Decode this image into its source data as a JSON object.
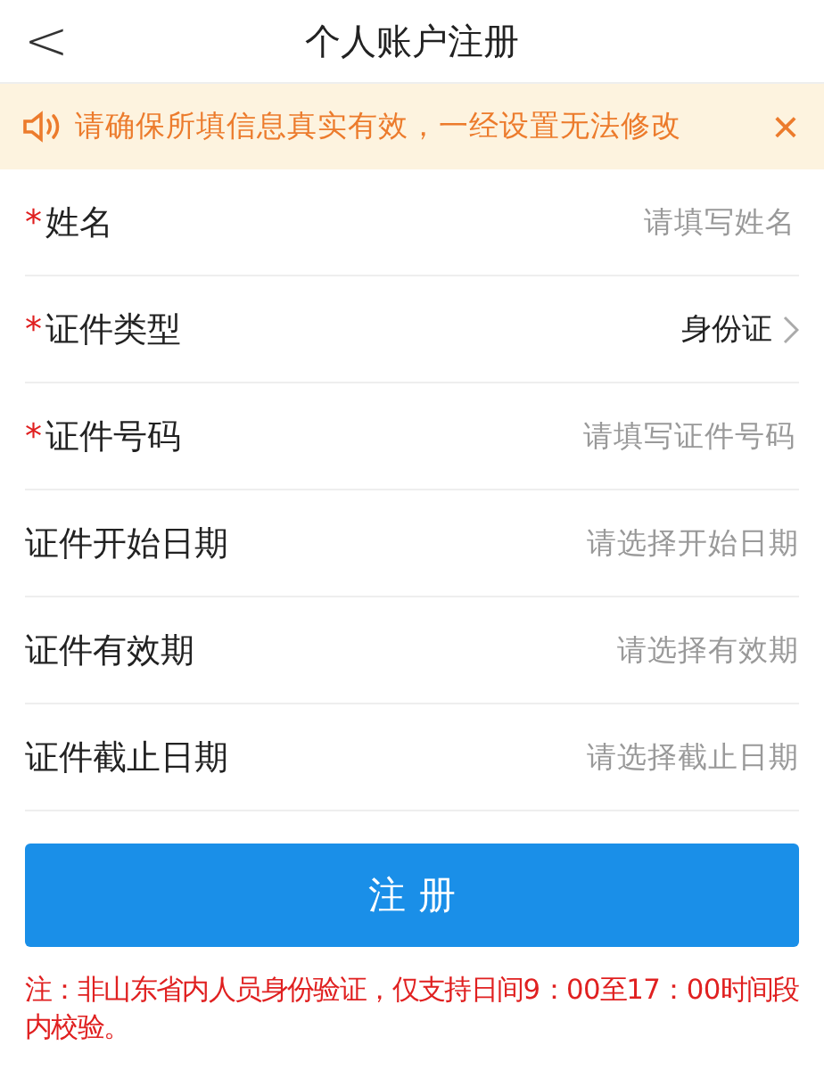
{
  "header": {
    "back": "<",
    "title": "个人账户注册"
  },
  "notice": {
    "text": "请确保所填信息真实有效，一经设置无法修改",
    "close": "×"
  },
  "fields": [
    {
      "kind": "input",
      "label": "姓名",
      "mark": "*",
      "placeholder": "请填写姓名"
    },
    {
      "kind": "select",
      "label": "证件类型",
      "mark": "*",
      "value": "身份证"
    },
    {
      "kind": "input",
      "label": "证件号码",
      "mark": "*",
      "placeholder": "请填写证件号码"
    },
    {
      "kind": "picker",
      "label": "证件开始日期",
      "placeholder": "请选择开始日期"
    },
    {
      "kind": "picker",
      "label": "证件有效期",
      "placeholder": "请选择有效期"
    },
    {
      "kind": "picker",
      "label": "证件截止日期",
      "placeholder": "请选择截止日期"
    }
  ],
  "submit": "注 册",
  "note": "注：非山东省内人员身份验证，仅支持日间9：00至17：00时间段内校验。"
}
